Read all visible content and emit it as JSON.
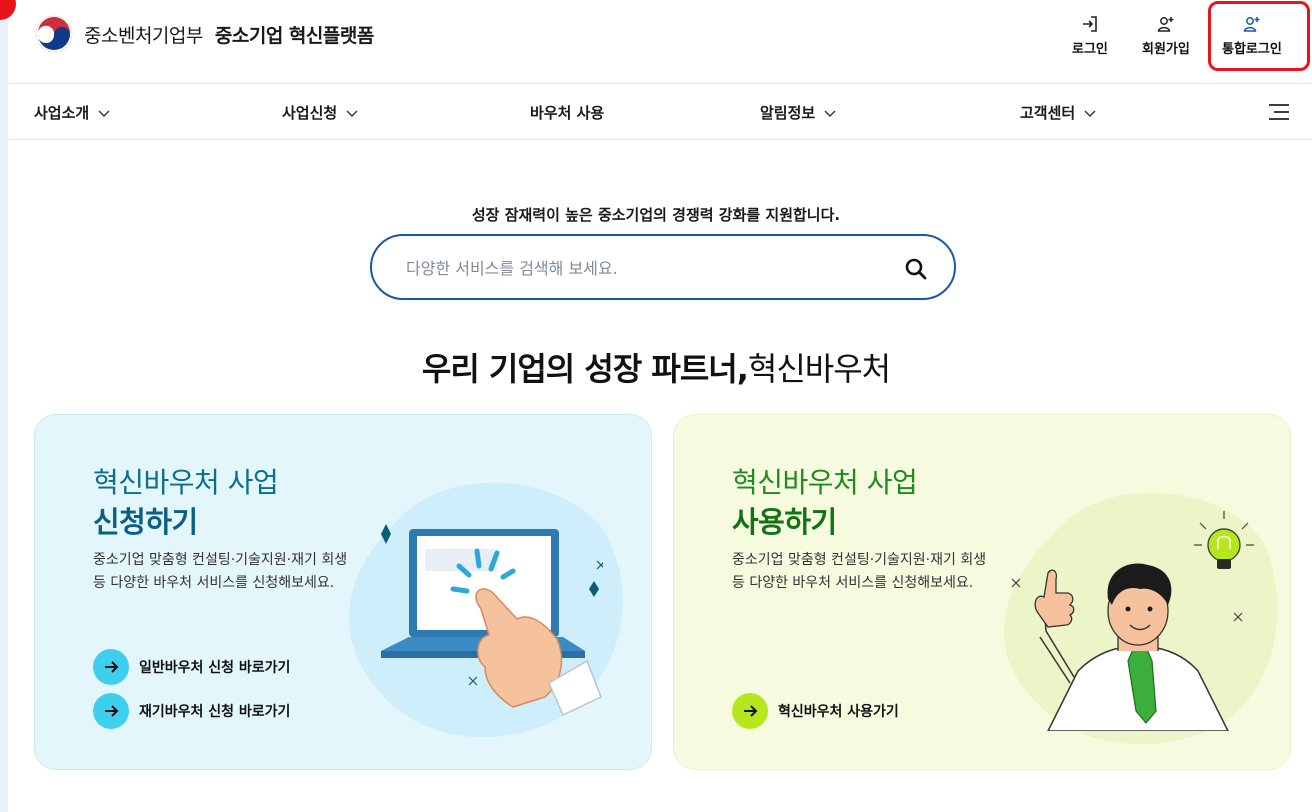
{
  "header": {
    "logo_icon": "taegeuk-icon",
    "ministry": "중소벤처기업부",
    "platform": "중소기업 혁신플랫폼",
    "util": {
      "login": "로그인",
      "signup": "회원가입",
      "sso": "통합로그인"
    }
  },
  "nav": {
    "items": [
      {
        "label": "사업소개",
        "has_dropdown": true
      },
      {
        "label": "사업신청",
        "has_dropdown": true
      },
      {
        "label": "바우처 사용",
        "has_dropdown": false
      },
      {
        "label": "알림정보",
        "has_dropdown": true
      },
      {
        "label": "고객센터",
        "has_dropdown": true
      }
    ],
    "menu_icon": "hamburger-menu-icon"
  },
  "hero": {
    "tagline": "성장 잠재력이 높은 중소기업의 경쟁력 강화를 지원합니다.",
    "search_placeholder": "다양한 서비스를 검색해 보세요.",
    "headline_bold": "우리 기업의 성장 파트너,",
    "headline_light": "혁신바우처"
  },
  "cards": {
    "apply": {
      "title_light": "혁신바우처 사업",
      "title_bold": "신청하기",
      "desc": "중소기업 맞춤형 컨설팅·기술지원·재기 회생 등 다양한 바우처 서비스를 신청해보세요.",
      "links": [
        "일반바우처 신청 바로가기",
        "재기바우처 신청 바로가기"
      ]
    },
    "use": {
      "title_light": "혁신바우처 사업",
      "title_bold": "사용하기",
      "desc": "중소기업 맞춤형 컨설팅·기술지원·재기 회생 등 다양한 바우처 서비스를 신청해보세요.",
      "links": [
        "혁신바우처 사용가기"
      ]
    }
  },
  "colors": {
    "brand_blue": "#1f56a8",
    "highlight_red": "#e8141b",
    "apply_bg": "#e3f6fc",
    "use_bg": "#f6fbdf",
    "apply_arrow": "#3fcfee",
    "use_arrow": "#b6e61c"
  }
}
